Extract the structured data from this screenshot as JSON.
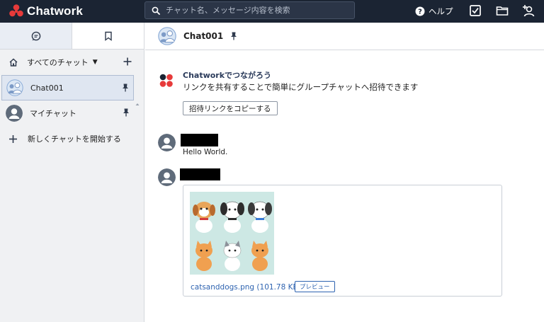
{
  "app": {
    "name": "Chatwork",
    "brand_colors": [
      "#e73a3a",
      "#1b2433"
    ]
  },
  "topbar": {
    "search_placeholder": "チャット名、メッセージ内容を検索",
    "help_label": "ヘルプ",
    "icons": [
      "search-icon",
      "help-icon",
      "task-checkbox-icon",
      "folder-icon",
      "add-contact-icon"
    ]
  },
  "sidebar": {
    "tabs": [
      {
        "icon": "chat-bubble-icon",
        "active": true
      },
      {
        "icon": "bookmark-icon",
        "active": false
      }
    ],
    "filter_label": "すべてのチャット",
    "rooms": [
      {
        "name": "Chat001",
        "active": true,
        "pinned": true
      },
      {
        "name": "マイチャット",
        "active": false,
        "pinned": true
      }
    ],
    "new_chat_label": "新しくチャットを開始する"
  },
  "room_header": {
    "name": "Chat001",
    "pinned": true
  },
  "invite": {
    "title": "Chatworkでつながろう",
    "text": "リンクを共有することで簡単にグループチャットへ招待できます",
    "button_label": "招待リンクをコピーする"
  },
  "messages": [
    {
      "sender_redacted": true,
      "text": "Hello World."
    },
    {
      "sender_redacted": true,
      "attachment": {
        "file_name": "catsanddogs.png (101.78 KB)",
        "preview_label": "プレビュー"
      }
    }
  ]
}
